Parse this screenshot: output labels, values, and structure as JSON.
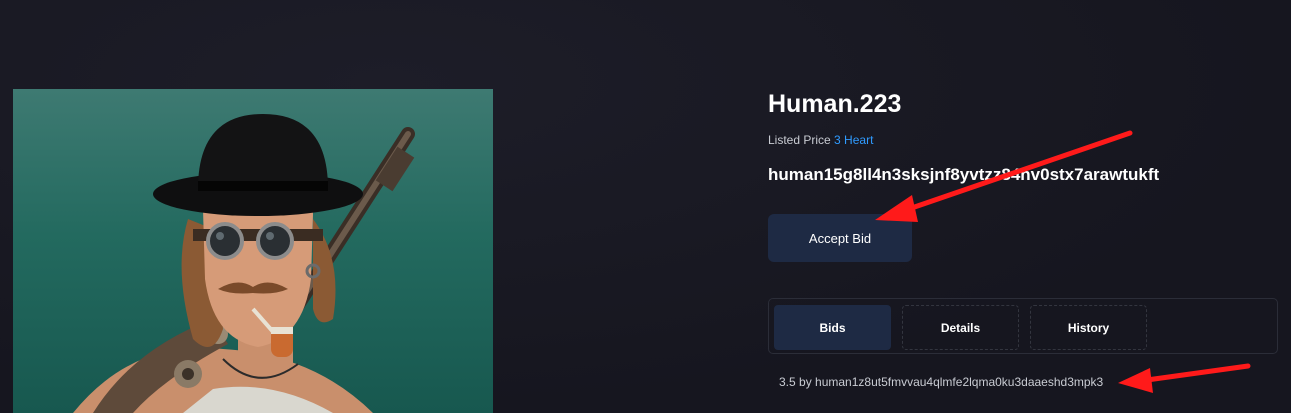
{
  "nft": {
    "title": "Human.223",
    "listed_price_label": "Listed Price",
    "listed_price_value": "3 Heart",
    "owner_address": "human15g8ll4n3sksjnf8yvtzz84nv0stx7arawtukft"
  },
  "actions": {
    "accept_bid_label": "Accept Bid"
  },
  "tabs": [
    {
      "label": "Bids",
      "active": true
    },
    {
      "label": "Details",
      "active": false
    },
    {
      "label": "History",
      "active": false
    }
  ],
  "bids": [
    {
      "text": "3.5 by human1z8ut5fmvvau4qlmfe2lqma0ku3daaeshd3mpk3"
    }
  ],
  "colors": {
    "background": "#181822",
    "button": "#1e2a44",
    "price_link": "#2f9bff",
    "annotation_arrow": "#ff1a1a"
  }
}
